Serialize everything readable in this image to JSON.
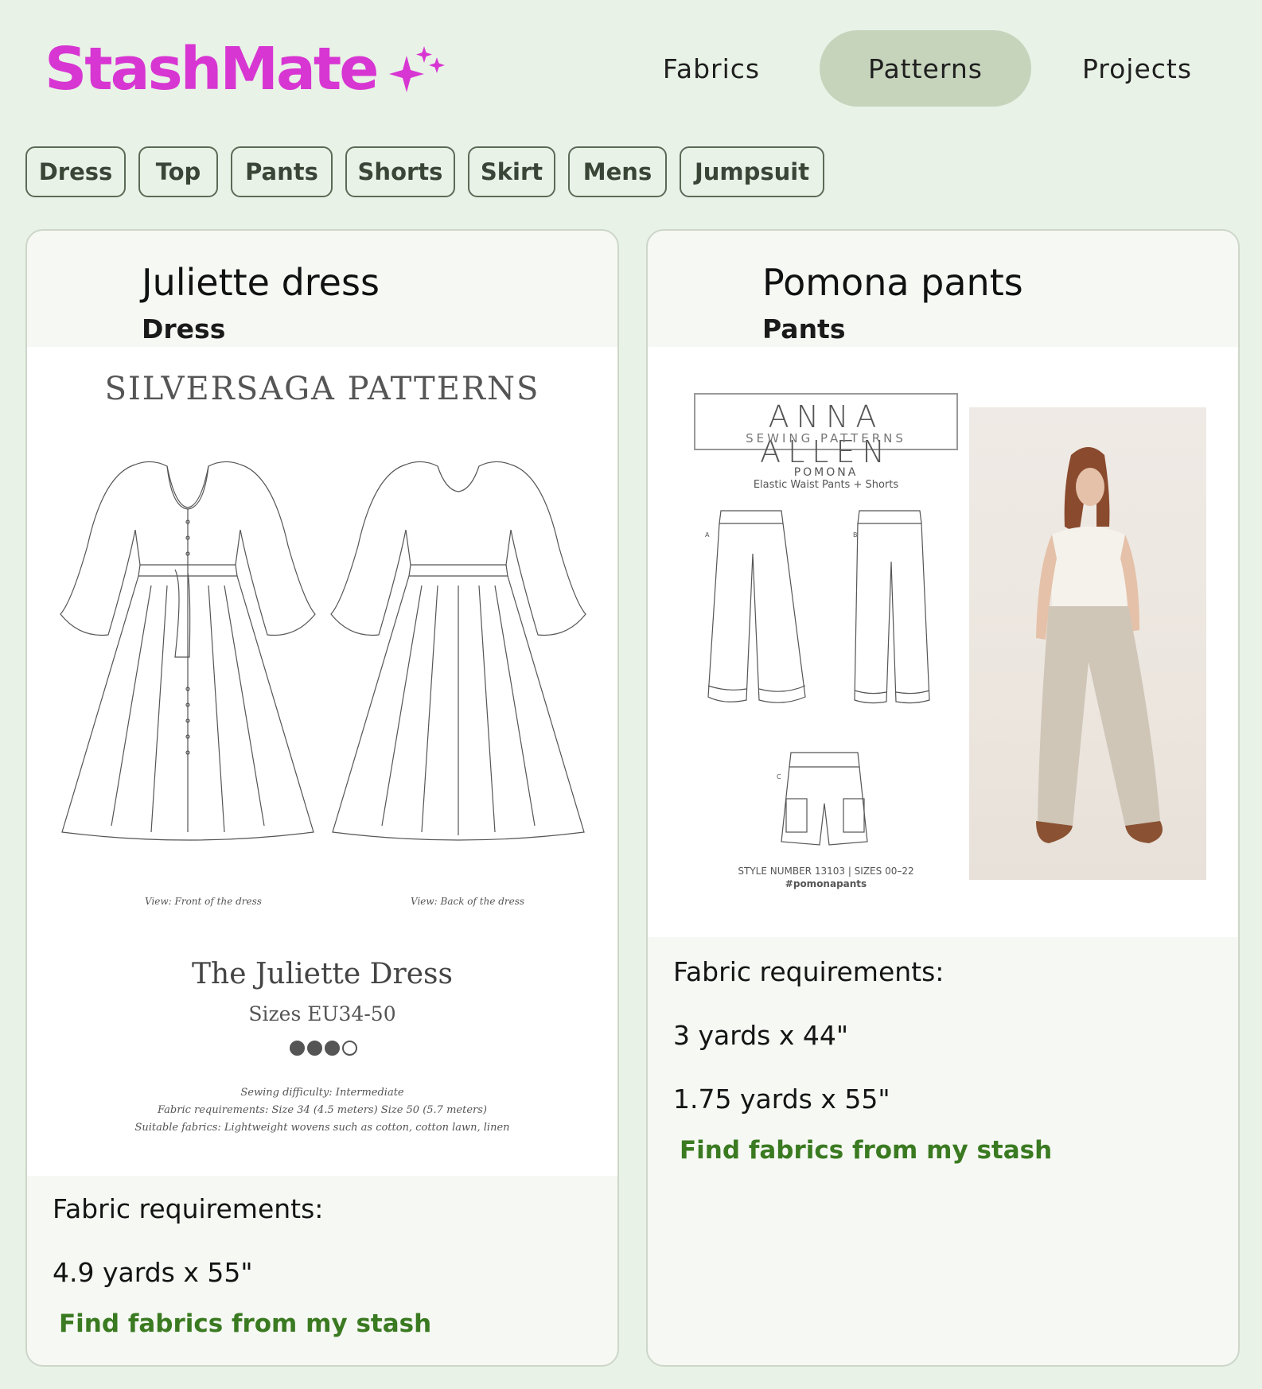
{
  "app": {
    "logo_text": "StashMate",
    "brand_color": "#d736d2",
    "sparkle_icon": "sparkle-icon"
  },
  "nav": {
    "items": [
      {
        "label": "Fabrics",
        "active": false
      },
      {
        "label": "Patterns",
        "active": true
      },
      {
        "label": "Projects",
        "active": false
      }
    ],
    "active_bg": "#c6d4bc"
  },
  "filters": [
    "Dress",
    "Top",
    "Pants",
    "Shorts",
    "Skirt",
    "Mens",
    "Jumpsuit"
  ],
  "cards": [
    {
      "title": "Juliette dress",
      "category": "Dress",
      "image": {
        "brand": "SILVERSAGA PATTERNS",
        "caption_front": "View: Front of the dress",
        "caption_back": "View: Back of the dress",
        "pattern_name": "The Juliette Dress",
        "sizes": "Sizes EU34-50",
        "difficulty_level": 3,
        "difficulty_max": 4,
        "difficulty_text": "Sewing difficulty: Intermediate",
        "fabric_text": "Fabric requirements: Size 34 (4.5 meters) Size 50 (5.7 meters)",
        "suitable_text": "Suitable fabrics: Lightweight wovens such as cotton, cotton lawn, linen"
      },
      "requirements_label": "Fabric requirements:",
      "requirements": [
        "4.9 yards x 55\""
      ],
      "link": "Find fabrics from my stash"
    },
    {
      "title": "Pomona pants",
      "category": "Pants",
      "image": {
        "brand_main": "ANNA ALLEN",
        "brand_sub": "SEWING PATTERNS",
        "pattern_name": "POMONA",
        "pattern_desc": "Elastic Waist Pants + Shorts",
        "view_a": "A",
        "view_b": "B",
        "view_c": "C",
        "style_line": "STYLE NUMBER 13103 | SIZES 00–22",
        "hashtag": "#pomonapants"
      },
      "requirements_label": "Fabric requirements:",
      "requirements": [
        "3 yards x 44\"",
        "1.75 yards x 55\""
      ],
      "link": "Find fabrics from my stash"
    }
  ],
  "colors": {
    "page_bg": "#e9f2e7",
    "card_bg": "#f6f8f3",
    "link_green": "#3a7a21"
  }
}
